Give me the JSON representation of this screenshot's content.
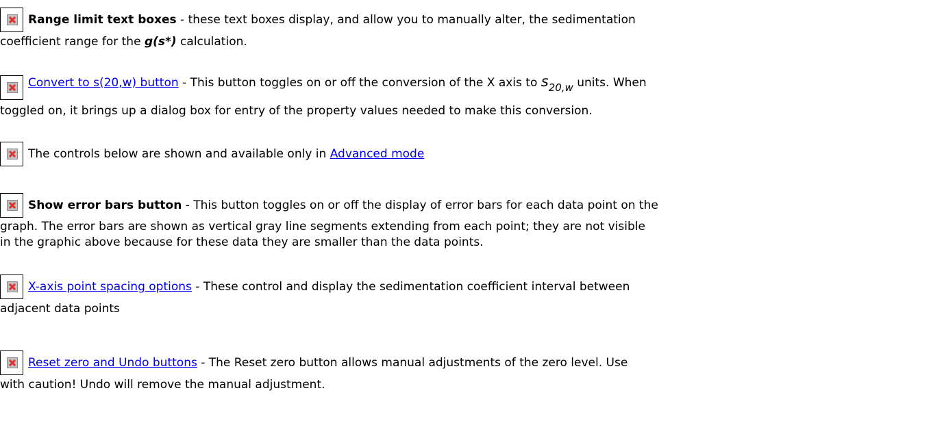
{
  "entries": [
    {
      "icon": "broken-image-icon",
      "bold": "Range limit text boxes",
      "text1": " - these text boxes display, and allow you to manually alter, the sedimentation",
      "line2_pre": "coefficient range for the ",
      "line2_italic": "g(s*)",
      "line2_post": " calculation."
    },
    {
      "icon": "broken-image-icon",
      "link": "Convert to s(20,w) button",
      "text1": " - This button toggles on or off the conversion of the X axis to ",
      "s_main": "s",
      "s_sub": "20,w",
      "text1_post": " units. When",
      "line2": "toggled on, it brings up a dialog box for entry of the property values needed to make this conversion."
    },
    {
      "icon": "broken-image-icon",
      "text1": "The controls below are shown and available only in ",
      "link": "Advanced mode"
    },
    {
      "icon": "broken-image-icon",
      "bold": "Show error bars button",
      "text1": " - This button toggles on or off the display of error bars for each data point on the",
      "line2": "graph. The error bars are shown as vertical gray line segments extending from each point; they are not visible",
      "line3": "in the graphic above because for these data they are smaller than the data points."
    },
    {
      "icon": "broken-image-icon",
      "link": "X-axis point spacing options",
      "text1": " - These control and display the sedimentation coefficient interval between",
      "line2": "adjacent data points"
    },
    {
      "icon": "broken-image-icon",
      "link": "Reset zero and Undo buttons",
      "text1": " - The Reset zero button allows manual adjustments of the zero level. Use",
      "line2": "with caution! Undo will remove the manual adjustment."
    }
  ],
  "colors": {
    "link": "#0000ee",
    "icon_red": "#e0302a"
  }
}
